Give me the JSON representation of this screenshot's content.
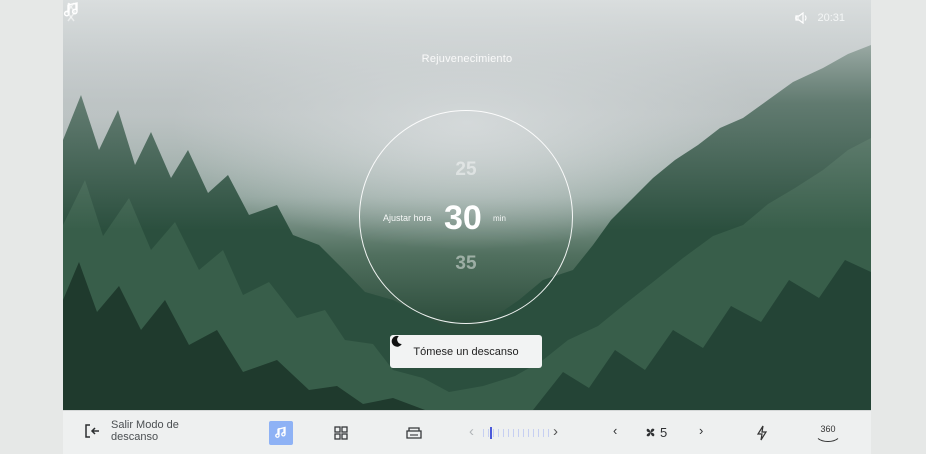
{
  "status": {
    "time": "20:31"
  },
  "scene": {
    "title": "Rejuvenecimiento"
  },
  "dial": {
    "label": "Ajustar hora",
    "prev_value": "25",
    "current_value": "30",
    "next_value": "35",
    "unit": "min"
  },
  "actions": {
    "rest_label": "Tómese un descanso"
  },
  "bottom_bar": {
    "exit_label": "Salir Modo de descanso",
    "fan_level": "5",
    "view_label": "360",
    "temperature_level": 0.1
  },
  "colors": {
    "accent": "#8eb2f5",
    "bar_background": "#eef0f0",
    "button_background": "#f2f3f3"
  },
  "icons": [
    "volume-icon",
    "music-note-icon",
    "moon-icon",
    "exit-icon",
    "grid-icon",
    "seat-icon",
    "fan-icon",
    "flash-icon",
    "view-360-icon"
  ]
}
